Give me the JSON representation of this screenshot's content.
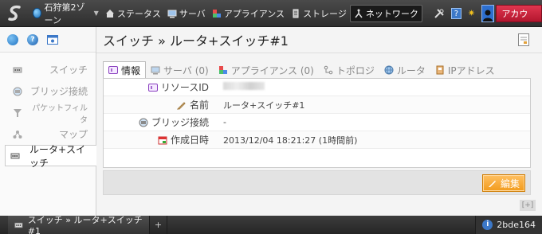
{
  "topbar": {
    "zone_label": "石狩第2ゾーン",
    "nav": [
      {
        "label": "ステータス",
        "icon": "home-icon"
      },
      {
        "label": "サーバ",
        "icon": "server-icon"
      },
      {
        "label": "アプライアンス",
        "icon": "appliance-icon"
      },
      {
        "label": "ストレージ",
        "icon": "storage-icon"
      },
      {
        "label": "ネットワーク",
        "icon": "network-icon"
      }
    ],
    "help_label": "?",
    "account_label": "アカウント"
  },
  "sidebar": {
    "items": [
      {
        "label": "スイッチ"
      },
      {
        "label": "ブリッジ接続"
      },
      {
        "label": "パケットフィルタ"
      },
      {
        "label": "マップ"
      },
      {
        "label": "ルータ+スイッチ"
      }
    ]
  },
  "main": {
    "title": "スイッチ » ルータ+スイッチ#1",
    "tabs": [
      {
        "label": "情報"
      },
      {
        "label": "サーバ (0)"
      },
      {
        "label": "アプライアンス (0)"
      },
      {
        "label": "トポロジ"
      },
      {
        "label": "ルータ"
      },
      {
        "label": "IPアドレス"
      }
    ],
    "fields": [
      {
        "key": "リソースID",
        "value": ""
      },
      {
        "key": "名前",
        "value": "ルータ+スイッチ#1"
      },
      {
        "key": "ブリッジ接続",
        "value": "-"
      },
      {
        "key": "作成日時",
        "value": "2013/12/04 18:21:27 (1時間前)"
      }
    ],
    "edit_label": "編集",
    "expand_label": "[+]"
  },
  "bottombar": {
    "tab_label": "スイッチ » ルータ+スイッチ#1",
    "plus_label": "+",
    "info_label": "i",
    "session_id": "2bde164"
  },
  "colors": {
    "account_red": "#cf1f3b",
    "edit_orange": "#f4a431",
    "help_blue": "#3c78c8"
  }
}
